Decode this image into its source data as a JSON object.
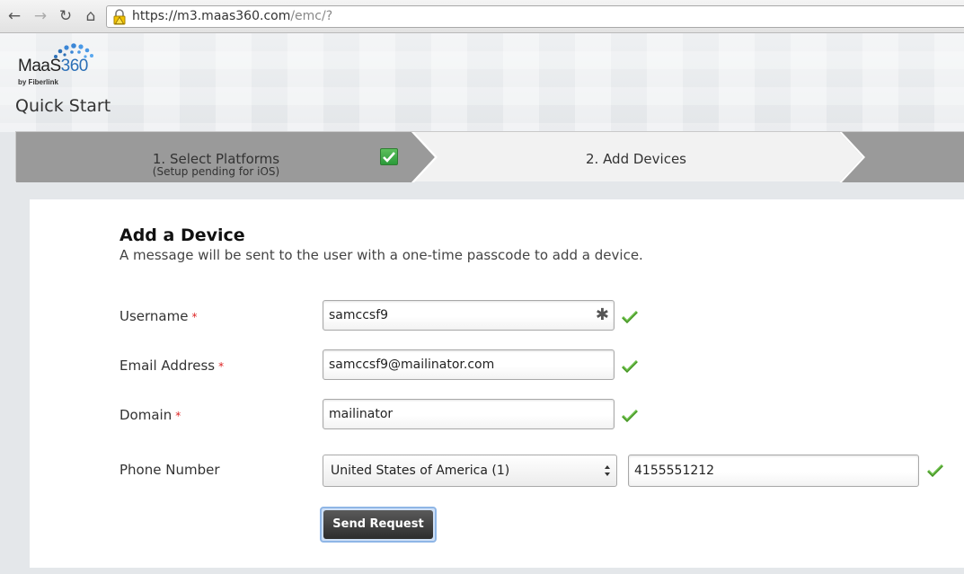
{
  "browser": {
    "url_host": "https://m3.maas360.com",
    "url_path": "/emc/?",
    "icons": [
      "back-icon",
      "forward-icon",
      "reload-icon",
      "home-icon",
      "lock-warning-icon"
    ]
  },
  "logo": {
    "brand_a": "MaaS",
    "brand_b": "360",
    "tagline": "by Fiberlink"
  },
  "page": {
    "title": "Quick Start"
  },
  "steps": [
    {
      "label": "1. Select Platforms",
      "sub": "(Setup pending for iOS)",
      "state": "complete"
    },
    {
      "label": "2. Add Devices",
      "state": "active"
    }
  ],
  "form": {
    "title": "Add a Device",
    "description": "A message will be sent to the user with a one-time passcode to add a device.",
    "required_mark": "*",
    "username_label": "Username",
    "username_value": "samccsf9",
    "username_star": "✱",
    "email_label": "Email Address",
    "email_value": "samccsf9@mailinator.com",
    "domain_label": "Domain",
    "domain_value": "mailinator",
    "phone_label": "Phone Number",
    "country_selected": "United States of America (1)",
    "phone_value": "4155551212",
    "submit_label": "Send Request"
  },
  "colors": {
    "accent_blue": "#2b6fb6",
    "check_green": "#6cc04a",
    "required_red": "#dd2222",
    "step_inactive": "#9a9a9a"
  }
}
